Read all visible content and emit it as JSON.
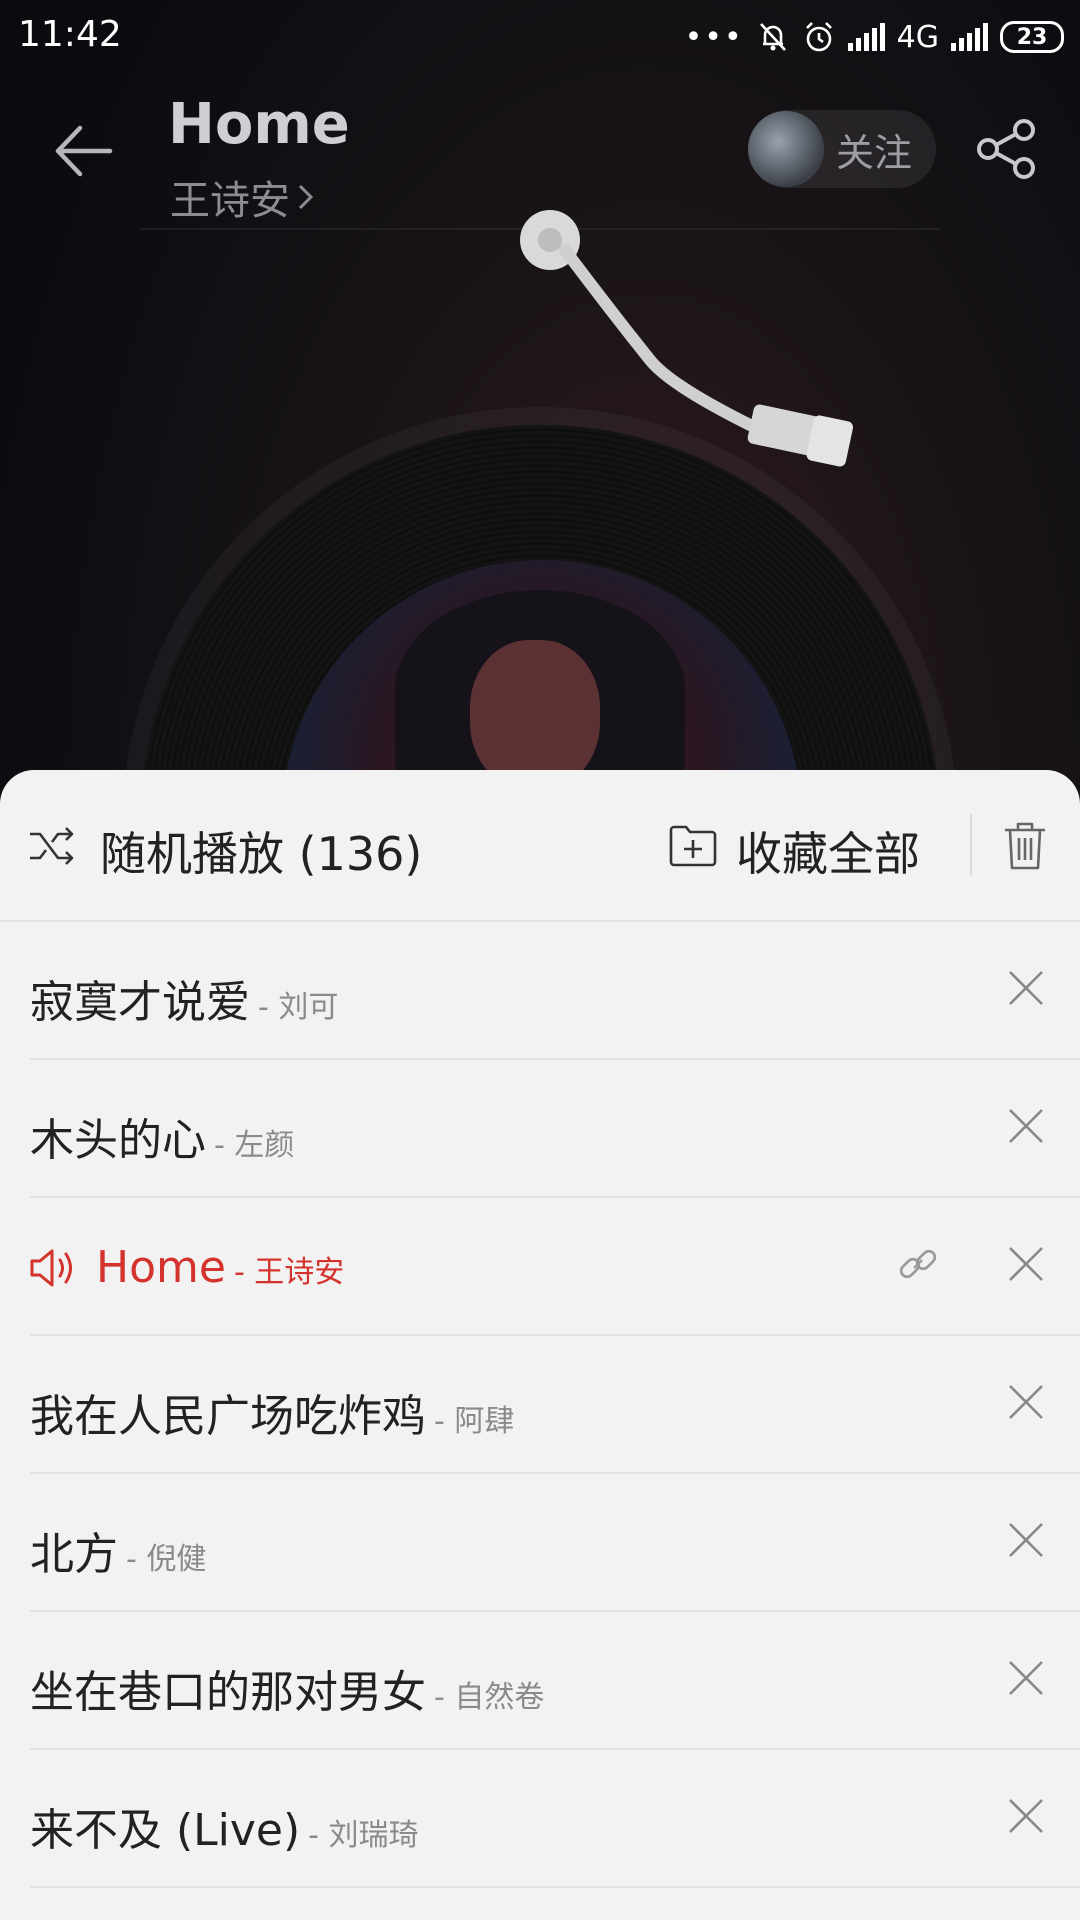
{
  "status_bar": {
    "time": "11:42",
    "network": "4G",
    "battery": "23"
  },
  "header": {
    "title": "Home",
    "artist": "王诗安",
    "follow_label": "关注"
  },
  "sheet": {
    "shuffle_label": "随机播放 (136)",
    "collect_all_label": "收藏全部"
  },
  "playlist": [
    {
      "title": "寂寞才说爱",
      "artist": "- 刘可"
    },
    {
      "title": "木头的心",
      "artist": "- 左颜"
    },
    {
      "title": "Home",
      "artist": "- 王诗安"
    },
    {
      "title": "我在人民广场吃炸鸡",
      "artist": "- 阿肆"
    },
    {
      "title": "北方",
      "artist": "- 倪健"
    },
    {
      "title": "坐在巷口的那对男女",
      "artist": "- 自然卷"
    },
    {
      "title": "来不及 (Live)",
      "artist": "- 刘瑞琦"
    }
  ],
  "current_index": 2,
  "colors": {
    "accent": "#d4322c",
    "sheet_bg": "#f2f2f2"
  }
}
